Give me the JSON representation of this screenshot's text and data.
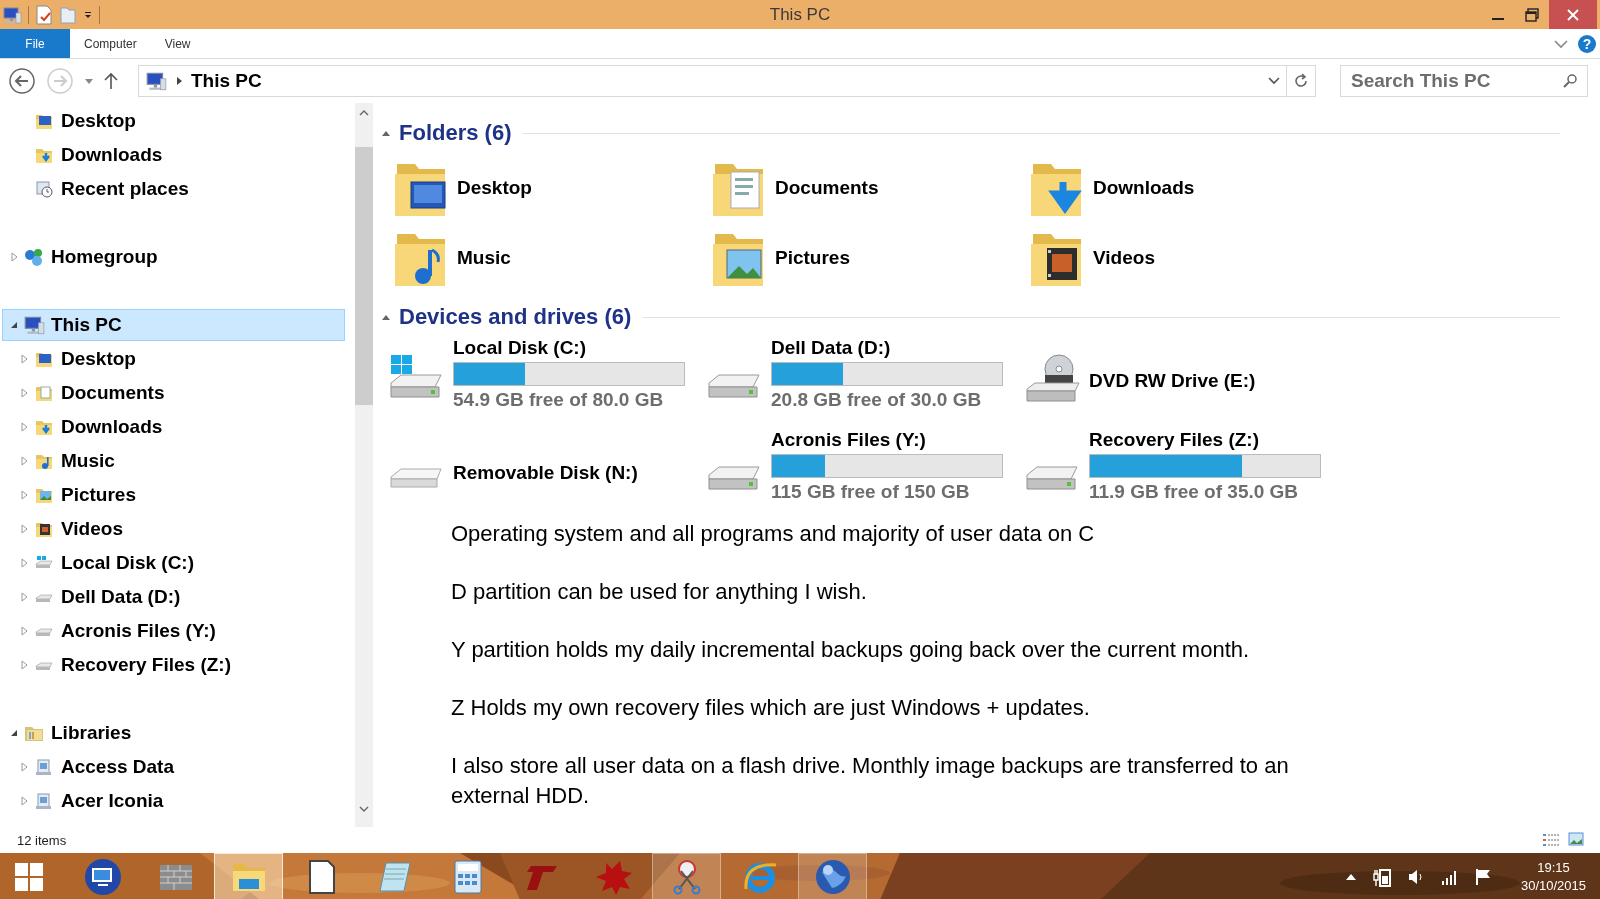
{
  "window": {
    "title": "This PC"
  },
  "ribbon": {
    "tabs": [
      {
        "label": "File",
        "kind": "file_menu"
      },
      {
        "label": "Computer",
        "kind": "tab"
      },
      {
        "label": "View",
        "kind": "tab"
      }
    ],
    "help": "?"
  },
  "address": {
    "path": "This PC",
    "search_placeholder": "Search This PC"
  },
  "navigation": {
    "groups": [
      {
        "children": [
          {
            "label": "Desktop",
            "kind": "desktop",
            "selected": false
          },
          {
            "label": "Downloads",
            "kind": "downloads",
            "selected": false
          },
          {
            "label": "Recent places",
            "kind": "recent",
            "selected": false
          }
        ]
      },
      {
        "label": "Homegroup",
        "kind": "homegroup",
        "expanded": false,
        "selected": false
      },
      {
        "label": "This PC",
        "kind": "pc",
        "expanded": true,
        "selected": true,
        "children": [
          {
            "label": "Desktop",
            "kind": "desktop",
            "expanded": false,
            "selected": false
          },
          {
            "label": "Documents",
            "kind": "documents",
            "expanded": false,
            "selected": false
          },
          {
            "label": "Downloads",
            "kind": "downloads",
            "expanded": false,
            "selected": false
          },
          {
            "label": "Music",
            "kind": "music",
            "expanded": false,
            "selected": false
          },
          {
            "label": "Pictures",
            "kind": "pictures",
            "expanded": false,
            "selected": false
          },
          {
            "label": "Videos",
            "kind": "videos",
            "expanded": false,
            "selected": false
          },
          {
            "label": "Local Disk (C:)",
            "kind": "system_disk",
            "expanded": false,
            "selected": false
          },
          {
            "label": "Dell Data (D:)",
            "kind": "disk",
            "expanded": false,
            "selected": false
          },
          {
            "label": "Acronis Files (Y:)",
            "kind": "disk",
            "expanded": false,
            "selected": false
          },
          {
            "label": "Recovery Files (Z:)",
            "kind": "disk",
            "expanded": false,
            "selected": false
          }
        ]
      },
      {
        "label": "Libraries",
        "kind": "library",
        "expanded": true,
        "selected": false,
        "children": [
          {
            "label": "Access Data",
            "kind": "library_item",
            "expanded": false,
            "selected": false
          },
          {
            "label": "Acer Iconia",
            "kind": "library_item",
            "expanded": false,
            "selected": false
          }
        ]
      }
    ]
  },
  "sections": [
    {
      "title": "Folders (6)",
      "expanded": true,
      "kind": "folders",
      "items": [
        {
          "name": "Desktop",
          "kind": "desktop"
        },
        {
          "name": "Documents",
          "kind": "documents"
        },
        {
          "name": "Downloads",
          "kind": "downloads"
        },
        {
          "name": "Music",
          "kind": "music"
        },
        {
          "name": "Pictures",
          "kind": "pictures"
        },
        {
          "name": "Videos",
          "kind": "videos"
        }
      ]
    },
    {
      "title": "Devices and drives (6)",
      "expanded": true,
      "kind": "drives",
      "items": [
        {
          "name": "Local Disk (C:)",
          "kind": "system_disk",
          "level": 0.31,
          "reading": "54.9 GB free of 80.0 GB"
        },
        {
          "name": "Dell Data (D:)",
          "kind": "disk",
          "level": 0.31,
          "reading": "20.8 GB free of 30.0 GB"
        },
        {
          "name": "DVD RW Drive (E:)",
          "kind": "dvd"
        },
        {
          "name": "Removable Disk (N:)",
          "kind": "removable"
        },
        {
          "name": "Acronis Files (Y:)",
          "kind": "disk",
          "level": 0.23,
          "reading": "115 GB free of 150 GB"
        },
        {
          "name": "Recovery Files (Z:)",
          "kind": "disk",
          "level": 0.66,
          "reading": "11.9 GB free of 35.0 GB"
        }
      ]
    }
  ],
  "annotation": {
    "paragraphs": [
      "Operating system and all programs and majority of user data on C",
      "D partition can be used for anything I wish.",
      "Y partition holds my daily incremental backups going back over the current month.",
      "Z Holds my own recovery files which are just Windows + updates.",
      "I also store all user data on a flash drive. Monthly image backups are transferred to an external HDD."
    ]
  },
  "status_bar": {
    "count": "12 items"
  },
  "taskbar": {
    "apps": [
      {
        "kind": "start",
        "running": false,
        "active": false
      },
      {
        "kind": "remote",
        "running": false,
        "active": false
      },
      {
        "kind": "firewall",
        "running": false,
        "active": false
      },
      {
        "kind": "explorer",
        "running": true,
        "active": true
      },
      {
        "kind": "document",
        "running": false,
        "active": false
      },
      {
        "kind": "notepad",
        "running": false,
        "active": false
      },
      {
        "kind": "calculator",
        "running": false,
        "active": false
      },
      {
        "kind": "red_logo",
        "running": false,
        "active": false
      },
      {
        "kind": "red_splat",
        "running": false,
        "active": false
      },
      {
        "kind": "snipping",
        "running": true,
        "active": false
      },
      {
        "kind": "ie",
        "running": false,
        "active": false
      },
      {
        "kind": "globe",
        "running": true,
        "active": false
      }
    ],
    "clock": {
      "time": "19:15",
      "date": "30/10/2015"
    }
  }
}
